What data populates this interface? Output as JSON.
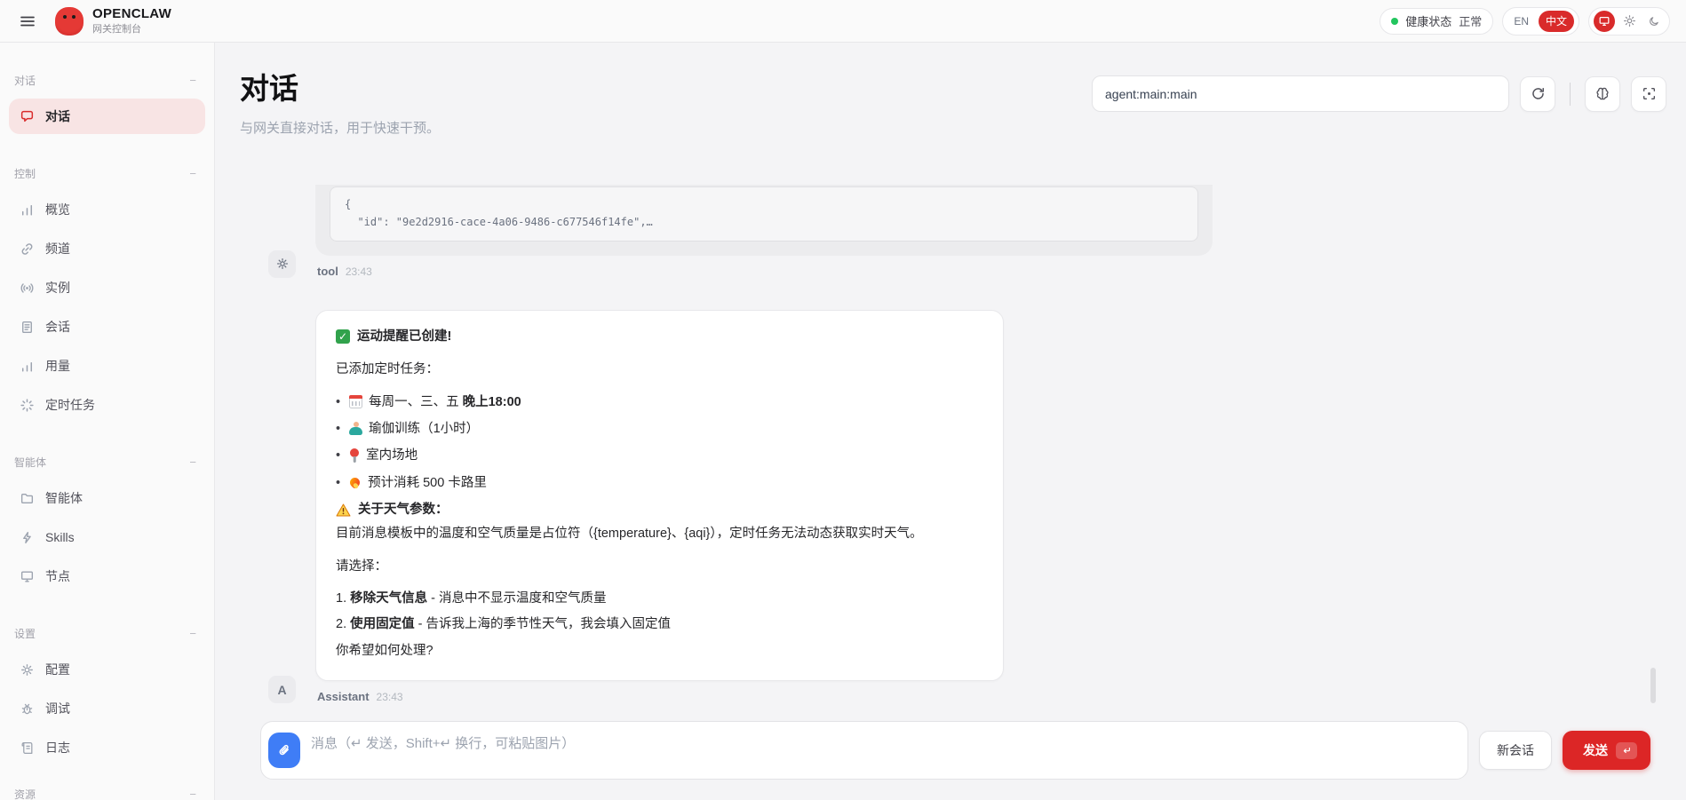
{
  "header": {
    "brand": "OPENCLAW",
    "brand_sub": "网关控制台",
    "health_label": "健康状态",
    "health_value": "正常",
    "lang_en": "EN",
    "lang_zh": "中文"
  },
  "sidebar": {
    "collapse_glyph": "−",
    "sections": [
      {
        "title": "对话",
        "items": [
          {
            "label": "对话"
          }
        ]
      },
      {
        "title": "控制",
        "items": [
          {
            "label": "概览"
          },
          {
            "label": "频道"
          },
          {
            "label": "实例"
          },
          {
            "label": "会话"
          },
          {
            "label": "用量"
          },
          {
            "label": "定时任务"
          }
        ]
      },
      {
        "title": "智能体",
        "items": [
          {
            "label": "智能体"
          },
          {
            "label": "Skills"
          },
          {
            "label": "节点"
          }
        ]
      },
      {
        "title": "设置",
        "items": [
          {
            "label": "配置"
          },
          {
            "label": "调试"
          },
          {
            "label": "日志"
          }
        ]
      },
      {
        "title": "资源",
        "items": []
      }
    ]
  },
  "page": {
    "title": "对话",
    "subtitle": "与网关直接对话，用于快速干预。",
    "agent_input": "agent:main:main"
  },
  "chat": {
    "tool_message": {
      "code": "{\n  \"id\": \"9e2d2916-cace-4a06-9486-c677546f14fe\",…",
      "sender": "tool",
      "time": "23:43"
    },
    "assistant_message": {
      "avatar": "A",
      "title": "运动提醒已创建!",
      "intro": "已添加定时任务：",
      "bullets": [
        {
          "text": "每周一、三、五 ",
          "bold": "晚上18:00"
        },
        {
          "text": "瑜伽训练（1小时）",
          "bold": ""
        },
        {
          "text": "室内场地",
          "bold": ""
        },
        {
          "text": "预计消耗 500 卡路里",
          "bold": ""
        }
      ],
      "warning_title": "关于天气参数：",
      "warning_body": "目前消息模板中的温度和空气质量是占位符（{temperature}、{aqi}），定时任务无法动态获取实时天气。",
      "choose": "请选择：",
      "options": [
        {
          "num": "1. ",
          "bold": "移除天气信息",
          "rest": " - 消息中不显示温度和空气质量"
        },
        {
          "num": "2. ",
          "bold": "使用固定值",
          "rest": " - 告诉我上海的季节性天气，我会填入固定值"
        }
      ],
      "question": "你希望如何处理?",
      "sender": "Assistant",
      "time": "23:43"
    }
  },
  "composer": {
    "placeholder": "消息（↵ 发送，Shift+↵ 换行，可粘贴图片）",
    "new_session": "新会话",
    "send": "发送"
  }
}
